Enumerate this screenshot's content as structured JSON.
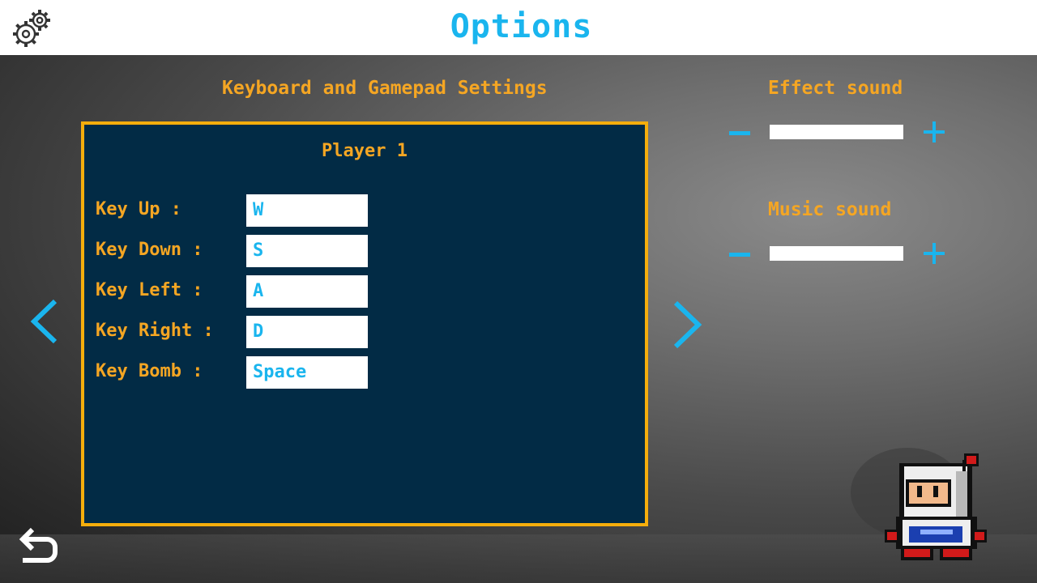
{
  "header": {
    "title": "Options",
    "settings_icon": "gears-icon"
  },
  "keyboard_section": {
    "title": "Keyboard and Gamepad Settings",
    "player_label": "Player 1",
    "bindings": [
      {
        "label": "Key Up :",
        "value": "W"
      },
      {
        "label": "Key Down :",
        "value": "S"
      },
      {
        "label": "Key Left :",
        "value": "A"
      },
      {
        "label": "Key Right :",
        "value": "D"
      },
      {
        "label": "Key Bomb :",
        "value": "Space"
      }
    ],
    "prev_icon": "chevron-left-icon",
    "next_icon": "chevron-right-icon"
  },
  "effect_sound": {
    "title": "Effect sound",
    "minus_icon": "minus-icon",
    "plus_icon": "plus-icon"
  },
  "music_sound": {
    "title": "Music sound",
    "minus_icon": "minus-icon",
    "plus_icon": "plus-icon"
  },
  "footer": {
    "back_icon": "return-arrow-icon"
  },
  "colors": {
    "accent_blue": "#1ab5ee",
    "label_orange": "#f5a623",
    "panel_bg": "#022b45",
    "panel_border": "#f5ae0c"
  }
}
